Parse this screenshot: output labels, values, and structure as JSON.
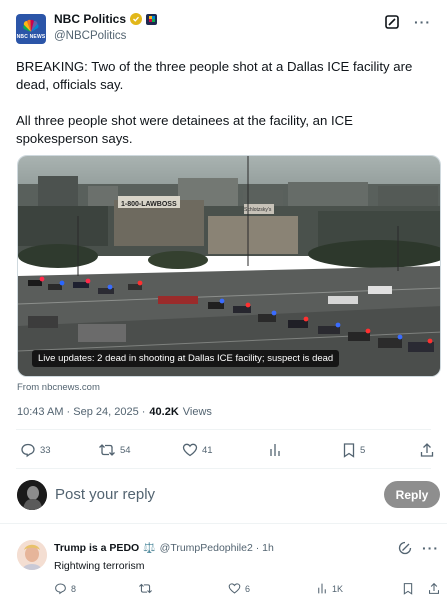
{
  "post": {
    "display_name": "NBC Politics",
    "handle": "@NBCPolitics",
    "avatar_text": "NBC NEWS",
    "text_paragraphs": [
      "BREAKING: Two of the three people shot at a Dallas ICE facility are dead, officials say.",
      "All three people shot were detainees at the facility, an ICE spokesperson says."
    ],
    "media": {
      "caption": "Live updates: 2 dead in shooting at Dallas ICE facility; suspect is dead",
      "sign_text": "1-800-LAWBOSS",
      "store_text": "Schlotzsky's"
    },
    "source": "From nbcnews.com",
    "timestamp": "10:43 AM · Sep 24, 2025 · ",
    "views_count": "40.2K",
    "views_label": "Views",
    "stats": {
      "replies": "33",
      "reposts": "54",
      "likes": "41",
      "bookmarks": "5"
    }
  },
  "composer": {
    "placeholder": "Post your reply",
    "reply_label": "Reply"
  },
  "reply": {
    "name": "Trump is a PEDO",
    "scales_emoji": "⚖️",
    "handle": "@TrumpPedophile2 · 1h",
    "text": "Rightwing terrorism",
    "stats": {
      "replies": "8",
      "reposts": "",
      "likes": "6",
      "views": "1K"
    }
  },
  "icons": [
    "nbc-peacock-icon",
    "verified-badge-icon",
    "affiliate-badge-icon",
    "grok-icon",
    "more-icon",
    "reply-icon",
    "repost-icon",
    "like-icon",
    "bookmark-icon",
    "share-icon",
    "views-icon"
  ],
  "colors": {
    "accent": "#1d9bf0",
    "text_secondary": "#536471",
    "reply_button": "#8e8e8e",
    "verified_gold": "#e2b719"
  }
}
